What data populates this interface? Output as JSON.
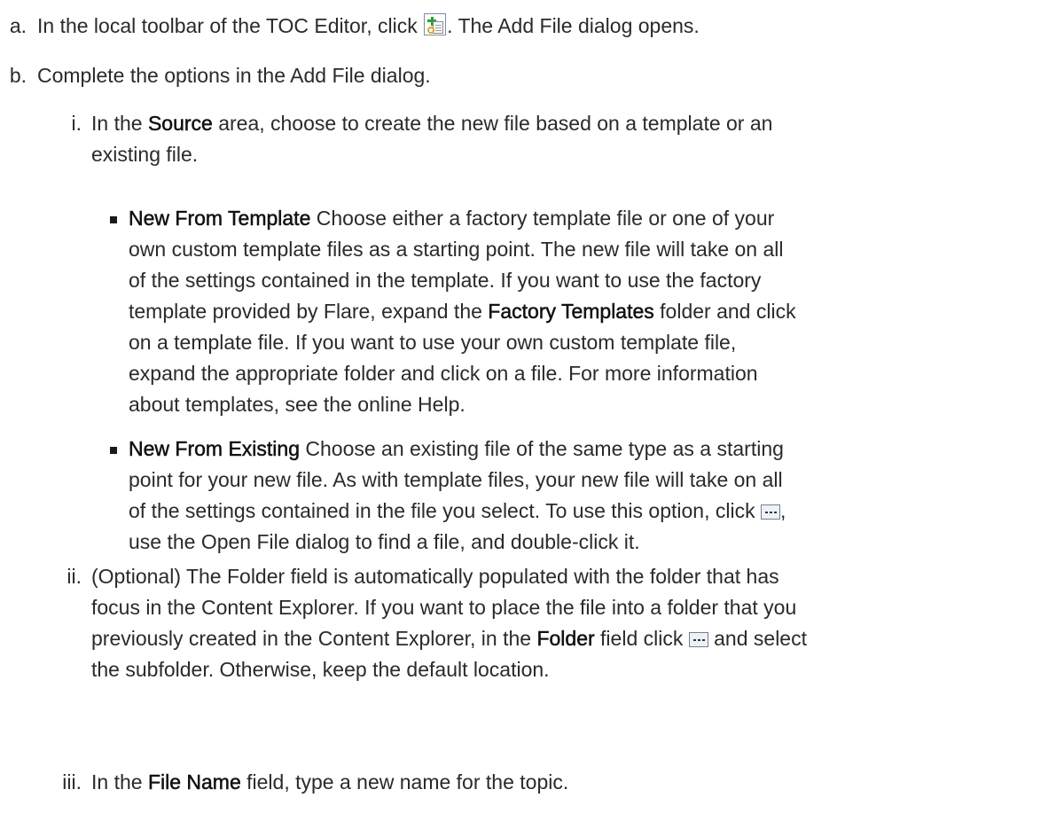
{
  "steps": [
    {
      "marker": "a.",
      "parts": [
        {
          "t": "In the local toolbar of the TOC Editor, click "
        },
        {
          "icon": "add-file-icon"
        },
        {
          "t": ". The Add File dialog opens."
        }
      ]
    },
    {
      "marker": "b.",
      "parts": [
        {
          "t": "Complete the options in the Add File dialog."
        }
      ]
    }
  ],
  "substeps": [
    {
      "marker": "i.",
      "lines": [
        [
          {
            "t": "In the "
          },
          {
            "b": "Source"
          },
          {
            "t": " area, choose to create the new file based on a template or an"
          }
        ],
        [
          {
            "t": "existing file."
          }
        ]
      ]
    },
    {
      "marker": "ii.",
      "lines": [
        [
          {
            "t": "(Optional) The Folder field is automatically populated with the folder that has"
          }
        ],
        [
          {
            "t": "focus in the Content Explorer. If you want to place the file into a folder that you"
          }
        ],
        [
          {
            "t": "previously created in the Content Explorer, in the "
          },
          {
            "b": "Folder"
          },
          {
            "t": " field click "
          },
          {
            "icon": "browse-icon"
          },
          {
            "t": " and select"
          }
        ],
        [
          {
            "t": "the subfolder. Otherwise, keep the default location."
          }
        ]
      ]
    },
    {
      "marker": "iii.",
      "lines": [
        [
          {
            "t": "In the "
          },
          {
            "b": "File Name"
          },
          {
            "t": " field, type a new name for the topic."
          }
        ]
      ]
    }
  ],
  "bullets": [
    {
      "lines": [
        [
          {
            "b": "New From Template"
          },
          {
            "t": " Choose either a factory template file or one of your"
          }
        ],
        [
          {
            "t": "own custom template files as a starting point. The new file will take on all"
          }
        ],
        [
          {
            "t": "of the settings contained in the template. If you want to use the factory"
          }
        ],
        [
          {
            "t": "template provided by Flare, expand the "
          },
          {
            "b": "Factory Templates"
          },
          {
            "t": " folder and click"
          }
        ],
        [
          {
            "t": "on a template file. If you want to use your own custom template file,"
          }
        ],
        [
          {
            "t": "expand the appropriate folder and click on a file. For more information"
          }
        ],
        [
          {
            "t": "about templates, see the online Help."
          }
        ]
      ]
    },
    {
      "lines": [
        [
          {
            "b": "New From Existing"
          },
          {
            "t": " Choose an existing file of the same type as a starting"
          }
        ],
        [
          {
            "t": "point for your new file. As with template files, your new file will take on all"
          }
        ],
        [
          {
            "t": "of the settings contained in the file you select. To use this option, click "
          },
          {
            "icon": "browse-icon"
          },
          {
            "t": ","
          }
        ],
        [
          {
            "t": "use the Open File dialog to find a file, and double-click it."
          }
        ]
      ]
    }
  ]
}
